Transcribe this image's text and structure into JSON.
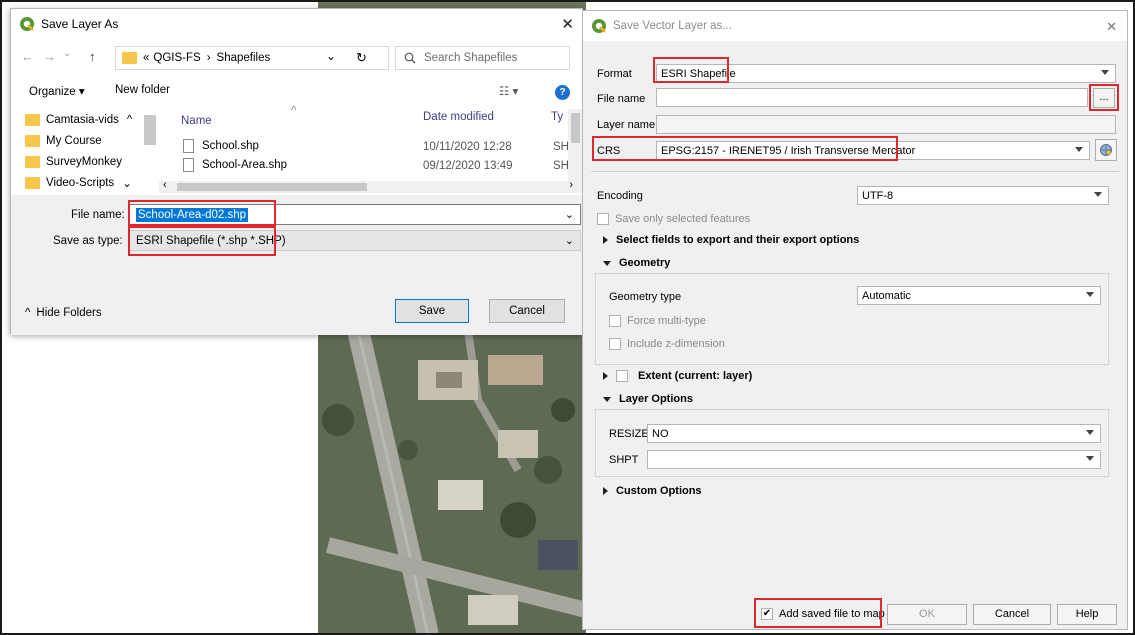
{
  "save_layer_dialog": {
    "title": "Save Layer As",
    "close": "✕",
    "back": "←",
    "forward": "→",
    "recent": "⌄",
    "up": "↑",
    "breadcrumb_prefix": "«",
    "breadcrumb": [
      "QGIS-FS",
      "›",
      "Shapefiles"
    ],
    "address_dropdown": "⌄",
    "refresh": "↻",
    "search_placeholder": "Search Shapefiles",
    "toolbar": {
      "organize": "Organize ▾",
      "new_folder": "New folder",
      "view": "☷ ▾",
      "help": "?"
    },
    "nav_folders": [
      "Camtasia-vids",
      "My Course",
      "SurveyMonkey",
      "Video-Scripts"
    ],
    "columns": {
      "name": "Name",
      "date": "Date modified",
      "type": "Ty"
    },
    "files": [
      {
        "name": "School.shp",
        "date": "10/11/2020 12:28",
        "type": "SH"
      },
      {
        "name": "School-Area.shp",
        "date": "09/12/2020 13:49",
        "type": "SH"
      }
    ],
    "file_name_label": "File name:",
    "file_name_value": "School-Area-d02.shp",
    "save_type_label": "Save as type:",
    "save_type_value": "ESRI Shapefile (*.shp *.SHP)",
    "hide_folders": "Hide Folders",
    "save_button": "Save",
    "cancel_button": "Cancel"
  },
  "save_vector_dialog": {
    "title": "Save Vector Layer as...",
    "close": "✕",
    "format_label": "Format",
    "format_value": "ESRI Shapefile",
    "file_name_label": "File name",
    "file_name_value": "",
    "browse_button": "...",
    "layer_name_label": "Layer name",
    "crs_label": "CRS",
    "crs_value": "EPSG:2157 - IRENET95 / Irish Transverse Mercator",
    "encoding_label": "Encoding",
    "encoding_value": "UTF-8",
    "save_selected_label": "Save only selected features",
    "select_fields_label": "Select fields to export and their export options",
    "geometry_section": "Geometry",
    "geometry_type_label": "Geometry type",
    "geometry_type_value": "Automatic",
    "force_multi_label": "Force multi-type",
    "include_z_label": "Include z-dimension",
    "extent_label": "Extent (current: layer)",
    "layer_options_section": "Layer Options",
    "resize_label": "RESIZE",
    "resize_value": "NO",
    "shpt_label": "SHPT",
    "shpt_value": "",
    "custom_options_section": "Custom Options",
    "add_to_map_label": "Add saved file to map",
    "add_to_map_checked": "✔",
    "ok_button": "OK",
    "cancel_button": "Cancel",
    "help_button": "Help"
  },
  "colors": {
    "highlight": "#e0262f",
    "selection": "#0078d7",
    "qgis_green": "#589632"
  }
}
